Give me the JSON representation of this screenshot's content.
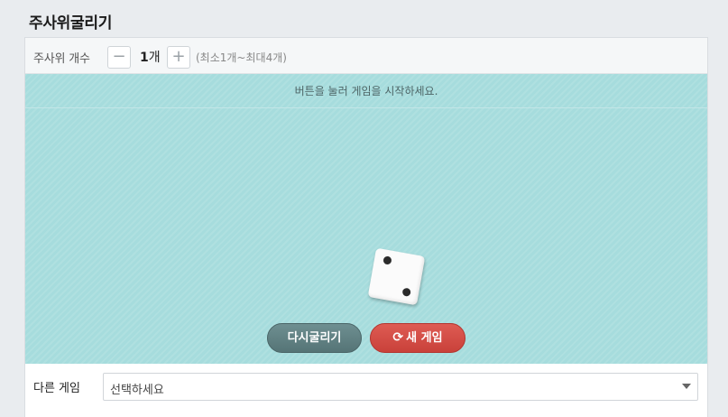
{
  "page": {
    "title": "주사위굴리기"
  },
  "controls": {
    "count_label": "주사위 개수",
    "minus_symbol": "−",
    "count_value": "1",
    "count_unit": "개",
    "plus_symbol": "+",
    "range_text": "(최소1개~최대4개)"
  },
  "board": {
    "message": "버튼을 눌러 게임을 시작하세요.",
    "background_color": "#a6dcdd",
    "dice": [
      {
        "value": 2
      }
    ]
  },
  "buttons": {
    "reroll_label": "다시굴리기",
    "new_game_icon": "refresh-icon",
    "new_game_label": "새 게임"
  },
  "footer": {
    "other_game_label": "다른 게임",
    "select_value": "선택하세요"
  }
}
